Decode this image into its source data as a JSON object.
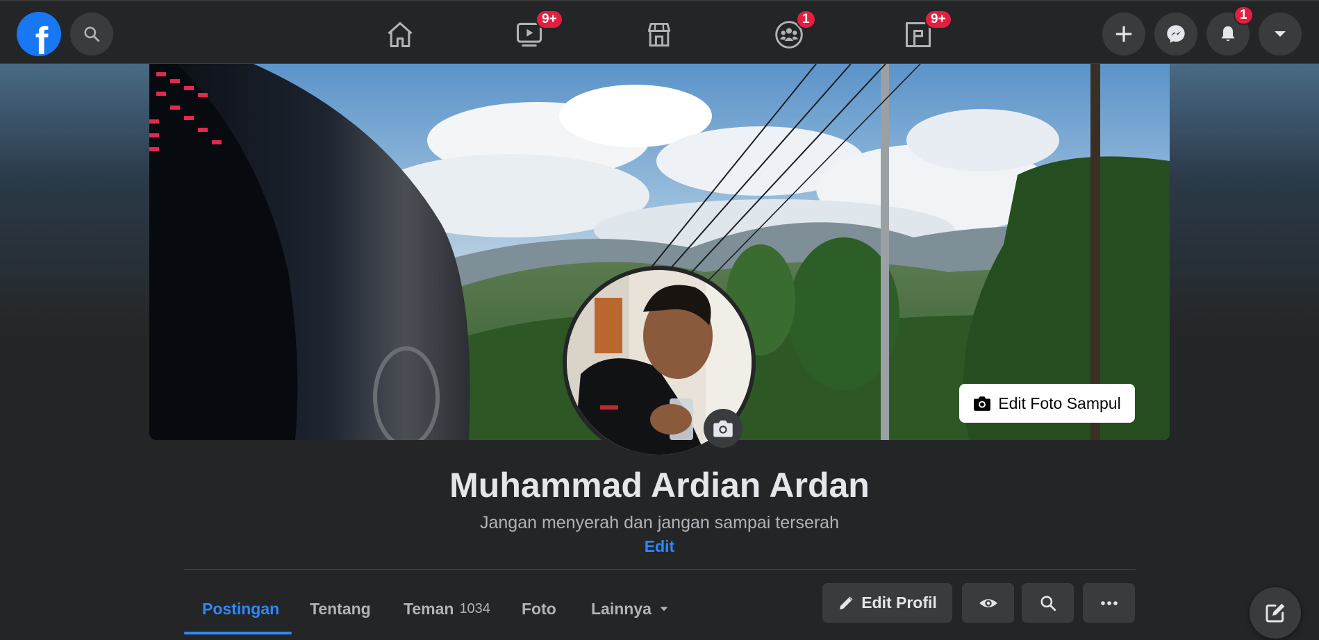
{
  "topbar": {
    "logo_letter": "f",
    "nav": [
      {
        "name": "home",
        "icon": "home-icon",
        "badge": ""
      },
      {
        "name": "watch",
        "icon": "watch-icon",
        "badge": "9+"
      },
      {
        "name": "marketplace",
        "icon": "marketplace-icon",
        "badge": ""
      },
      {
        "name": "groups",
        "icon": "groups-icon",
        "badge": "1"
      },
      {
        "name": "gaming",
        "icon": "gaming-icon",
        "badge": "9+"
      }
    ],
    "notifications_badge": "1"
  },
  "profile": {
    "name": "Muhammad Ardian Ardan",
    "bio": "Jangan menyerah dan jangan sampai terserah",
    "bio_edit_label": "Edit",
    "edit_cover_label": "Edit Foto Sampul"
  },
  "tabs": {
    "posts": "Postingan",
    "about": "Tentang",
    "friends": "Teman",
    "friends_count": "1034",
    "photos": "Foto",
    "more": "Lainnya"
  },
  "actions": {
    "edit_profile": "Edit Profil"
  },
  "colors": {
    "brand": "#1877f2",
    "accent": "#2d88ff",
    "badge": "#e41e3f",
    "surface": "#242526"
  }
}
